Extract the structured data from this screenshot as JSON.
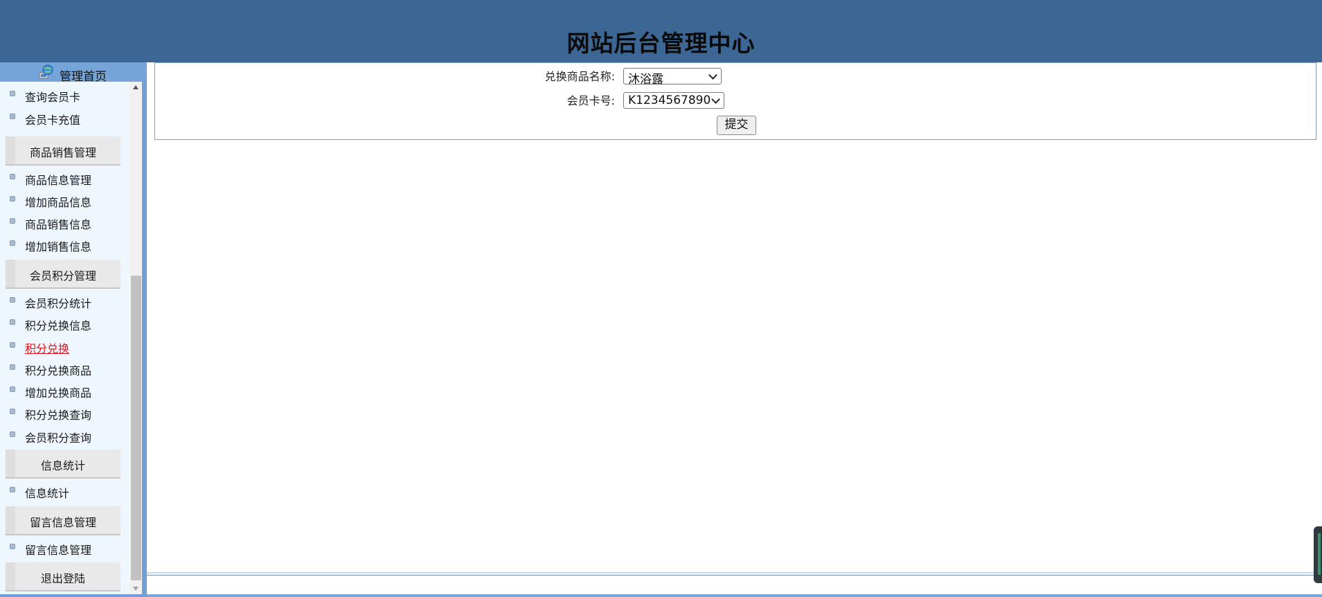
{
  "header": {
    "title": "网站后台管理中心"
  },
  "sidebar": {
    "home_label": "管理首页",
    "entries": [
      {
        "kind": "item",
        "label": "查询会员卡",
        "active": false
      },
      {
        "kind": "item",
        "label": "会员卡充值",
        "active": false
      },
      {
        "kind": "section",
        "label": "商品销售管理"
      },
      {
        "kind": "item",
        "label": "商品信息管理",
        "active": false
      },
      {
        "kind": "item",
        "label": "增加商品信息",
        "active": false
      },
      {
        "kind": "item",
        "label": "商品销售信息",
        "active": false
      },
      {
        "kind": "item",
        "label": "增加销售信息",
        "active": false
      },
      {
        "kind": "section",
        "label": "会员积分管理"
      },
      {
        "kind": "item",
        "label": "会员积分统计",
        "active": false
      },
      {
        "kind": "item",
        "label": "积分兑换信息",
        "active": false
      },
      {
        "kind": "item",
        "label": "积分兑换",
        "active": true
      },
      {
        "kind": "item",
        "label": "积分兑换商品",
        "active": false
      },
      {
        "kind": "item",
        "label": "增加兑换商品",
        "active": false
      },
      {
        "kind": "item",
        "label": "积分兑换查询",
        "active": false
      },
      {
        "kind": "item",
        "label": "会员积分查询",
        "active": false
      },
      {
        "kind": "section",
        "label": "信息统计"
      },
      {
        "kind": "item",
        "label": "信息统计",
        "active": false
      },
      {
        "kind": "section",
        "label": "留言信息管理"
      },
      {
        "kind": "item",
        "label": "留言信息管理",
        "active": false
      },
      {
        "kind": "section",
        "label": "退出登陆"
      }
    ]
  },
  "form": {
    "product_label": "兑换商品名称:",
    "product_value": "沐浴露",
    "card_label": "会员卡号:",
    "card_value": "K1234567890",
    "submit_label": "提交"
  },
  "colors": {
    "header_bg": "#3c6794",
    "sidebar_bg": "#eef6fe",
    "active_link": "#e4141e",
    "frame_blue": "#6f9fd5"
  }
}
